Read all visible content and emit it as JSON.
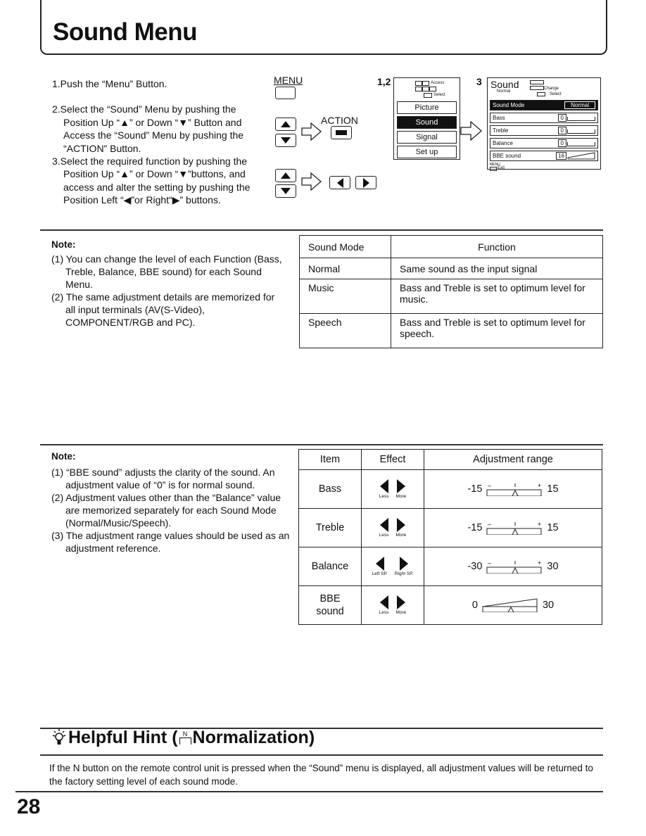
{
  "page": {
    "title": "Sound Menu",
    "page_number": "28"
  },
  "steps": [
    "1.Push the “Menu” Button.",
    "2.Select the “Sound” Menu by pushing the Position Up “▲” or Down “▼” Button and Access the “Sound” Menu by pushing the “ACTION” Button.",
    "3.Select the required function by pushing the Position Up “▲” or Down “▼”buttons, and access and alter the setting by pushing the Position Left “◀”or Right“▶” buttons."
  ],
  "remote": {
    "menu_label": "MENU",
    "action_label": "ACTION"
  },
  "main_menu": {
    "step_label": "1,2",
    "legend_access": "Access",
    "legend_select": "Select",
    "items": [
      "Picture",
      "Sound",
      "Signal",
      "Set up"
    ],
    "selected": "Sound"
  },
  "sound_menu": {
    "step_label": "3",
    "title": "Sound",
    "subtitle": "Normal",
    "legend_change": "Change",
    "legend_select": "Select",
    "rows": [
      {
        "label": "Sound Mode",
        "value": "Normal"
      },
      {
        "label": "Bass",
        "value": "0"
      },
      {
        "label": "Treble",
        "value": "0"
      },
      {
        "label": "Balance",
        "value": "0"
      },
      {
        "label": "BBE sound",
        "value": "16"
      }
    ],
    "exit_menu": "MENU",
    "exit_label": "Exit"
  },
  "note1": {
    "heading": "Note:",
    "items": [
      "(1) You can change the level of each Function (Bass, Treble, Balance, BBE sound) for each Sound Menu.",
      "(2) The same adjustment details are memorized for all input terminals (AV(S-Video), COMPONENT/RGB and PC)."
    ]
  },
  "mode_table": {
    "headers": [
      "Sound Mode",
      "Function"
    ],
    "rows": [
      [
        "Normal",
        "Same sound as the input signal"
      ],
      [
        "Music",
        "Bass and Treble is set to optimum level for music."
      ],
      [
        "Speech",
        "Bass and Treble is set to optimum level for speech."
      ]
    ]
  },
  "note2": {
    "heading": "Note:",
    "items": [
      "(1) “BBE sound” adjusts the clarity of the sound. An adjustment value of “0” is for normal sound.",
      "(2) Adjustment values other than the “Balance” value are memorized separately for each Sound Mode (Normal/Music/Speech).",
      "(3) The adjustment range values should be used as an adjustment reference."
    ]
  },
  "adjust_table": {
    "headers": [
      "Item",
      "Effect",
      "Adjustment range"
    ],
    "rows": [
      {
        "item": "Bass",
        "left": "Less",
        "right": "More",
        "min": "-15",
        "max": "15"
      },
      {
        "item": "Treble",
        "left": "Less",
        "right": "More",
        "min": "-15",
        "max": "15"
      },
      {
        "item": "Balance",
        "left": "Left SP.",
        "right": "Right SP.",
        "min": "-30",
        "max": "30"
      },
      {
        "item": "BBE sound",
        "left": "Less",
        "right": "More",
        "min": "0",
        "max": "30"
      }
    ]
  },
  "hint": {
    "title_prefix": "Helpful Hint (",
    "key_label": "N",
    "title_main": "Normalization)",
    "text": "If the N button on the remote control unit is pressed when the “Sound” menu is displayed, all adjustment values will be returned to the factory setting level of each sound mode."
  }
}
